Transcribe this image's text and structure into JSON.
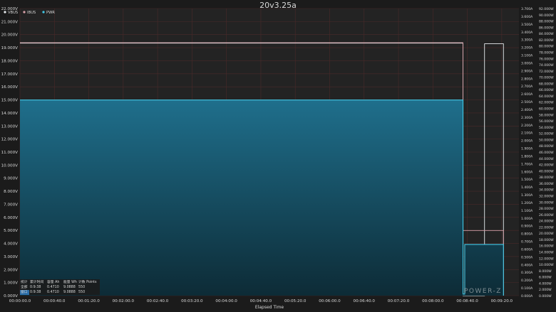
{
  "colors": {
    "background": "#1b1b1b",
    "plot_background": "#232323",
    "grid": "#4a2a2a",
    "vbus": "#e8ecef",
    "ibus": "#d9a1a9",
    "pwr": "#41c8e6",
    "fill_top": "#1f6f8c",
    "fill_bottom": "#0d2b36",
    "text": "#d8d8d8",
    "table_highlight": "#2d6ea8"
  },
  "chart_data": {
    "type": "line",
    "title": "20v3.25a",
    "xlabel": "Elapsed Time",
    "x_ticks": [
      "00:00:00.0",
      "00:00:40.0",
      "00:01:20.0",
      "00:02:00.0",
      "00:02:40.0",
      "00:03:20.0",
      "00:04:00.0",
      "00:04:40.0",
      "00:05:20.0",
      "00:06:00.0",
      "00:06:40.0",
      "00:07:20.0",
      "00:08:00.0",
      "00:08:40.0",
      "00:09:20.0"
    ],
    "xlim_seconds": [
      0,
      580
    ],
    "legend": [
      "VBUS",
      "IBUS",
      "PWR"
    ],
    "legend_position": "top-left",
    "y_left": {
      "ticks": [
        "0.000V",
        "1.000V",
        "2.000V",
        "3.000V",
        "4.000V",
        "5.000V",
        "6.000V",
        "7.000V",
        "8.000V",
        "9.000V",
        "10.000V",
        "11.000V",
        "12.000V",
        "13.000V",
        "14.000V",
        "15.000V",
        "16.000V",
        "17.000V",
        "18.000V",
        "19.000V",
        "20.000V",
        "21.000V",
        "22.000V"
      ],
      "lim": [
        0,
        22
      ]
    },
    "y_right_current": {
      "ticks": [
        "0.000A",
        "0.100A",
        "0.200A",
        "0.300A",
        "0.400A",
        "0.500A",
        "0.600A",
        "0.700A",
        "0.800A",
        "0.900A",
        "1.000A",
        "1.100A",
        "1.200A",
        "1.300A",
        "1.400A",
        "1.500A",
        "1.600A",
        "1.700A",
        "1.800A",
        "1.900A",
        "2.000A",
        "2.100A",
        "2.200A",
        "2.300A",
        "2.400A",
        "2.500A",
        "2.600A",
        "2.700A",
        "2.800A",
        "2.900A",
        "3.000A",
        "3.100A",
        "3.200A",
        "3.300A",
        "3.400A",
        "3.500A",
        "3.600A",
        "3.700A"
      ],
      "lim": [
        0,
        3.7
      ]
    },
    "y_right_power": {
      "ticks": [
        "0.000W",
        "2.000W",
        "4.000W",
        "6.000W",
        "8.000W",
        "10.000W",
        "12.000W",
        "14.000W",
        "16.000W",
        "18.000W",
        "20.000W",
        "22.000W",
        "24.000W",
        "26.000W",
        "28.000W",
        "30.000W",
        "32.000W",
        "34.000W",
        "36.000W",
        "38.000W",
        "40.000W",
        "42.000W",
        "44.000W",
        "46.000W",
        "48.000W",
        "50.000W",
        "52.000W",
        "54.000W",
        "56.000W",
        "58.000W",
        "60.000W",
        "62.000W",
        "64.000W",
        "66.000W",
        "68.000W",
        "70.000W",
        "72.000W",
        "74.000W",
        "76.000W",
        "78.000W",
        "80.000W",
        "82.000W",
        "84.000W",
        "86.000W",
        "88.000W",
        "90.000W",
        "92.000W"
      ],
      "lim": [
        0,
        92
      ]
    },
    "series": [
      {
        "name": "VBUS",
        "axis": "voltage",
        "points": [
          [
            0,
            19.35
          ],
          [
            515,
            19.35
          ],
          [
            515,
            0
          ],
          [
            540,
            0
          ],
          [
            540,
            19.3
          ],
          [
            562,
            19.3
          ],
          [
            562,
            0
          ]
        ]
      },
      {
        "name": "IBUS",
        "axis": "current",
        "points": [
          [
            0,
            3.26
          ],
          [
            515,
            3.26
          ],
          [
            515,
            0.84
          ],
          [
            562,
            0.84
          ],
          [
            562,
            0
          ]
        ]
      },
      {
        "name": "PWR",
        "axis": "power",
        "points": [
          [
            0,
            62.7
          ],
          [
            515,
            62.7
          ],
          [
            515,
            0.5
          ],
          [
            517,
            0.5
          ],
          [
            517,
            16.4
          ],
          [
            562,
            16.4
          ],
          [
            562,
            0
          ]
        ]
      }
    ],
    "stats_table": {
      "headers": [
        "统计",
        "累计时间",
        "容量 Ah",
        "能量 Wh",
        "计数 Points"
      ],
      "rows": [
        [
          "全部",
          "0:9:38",
          "0.4710",
          "9.0888",
          "550"
        ],
        [
          "窗口",
          "0:9:38",
          "0.4710",
          "9.0888",
          "550"
        ]
      ]
    },
    "watermark": "POWER-Z"
  }
}
